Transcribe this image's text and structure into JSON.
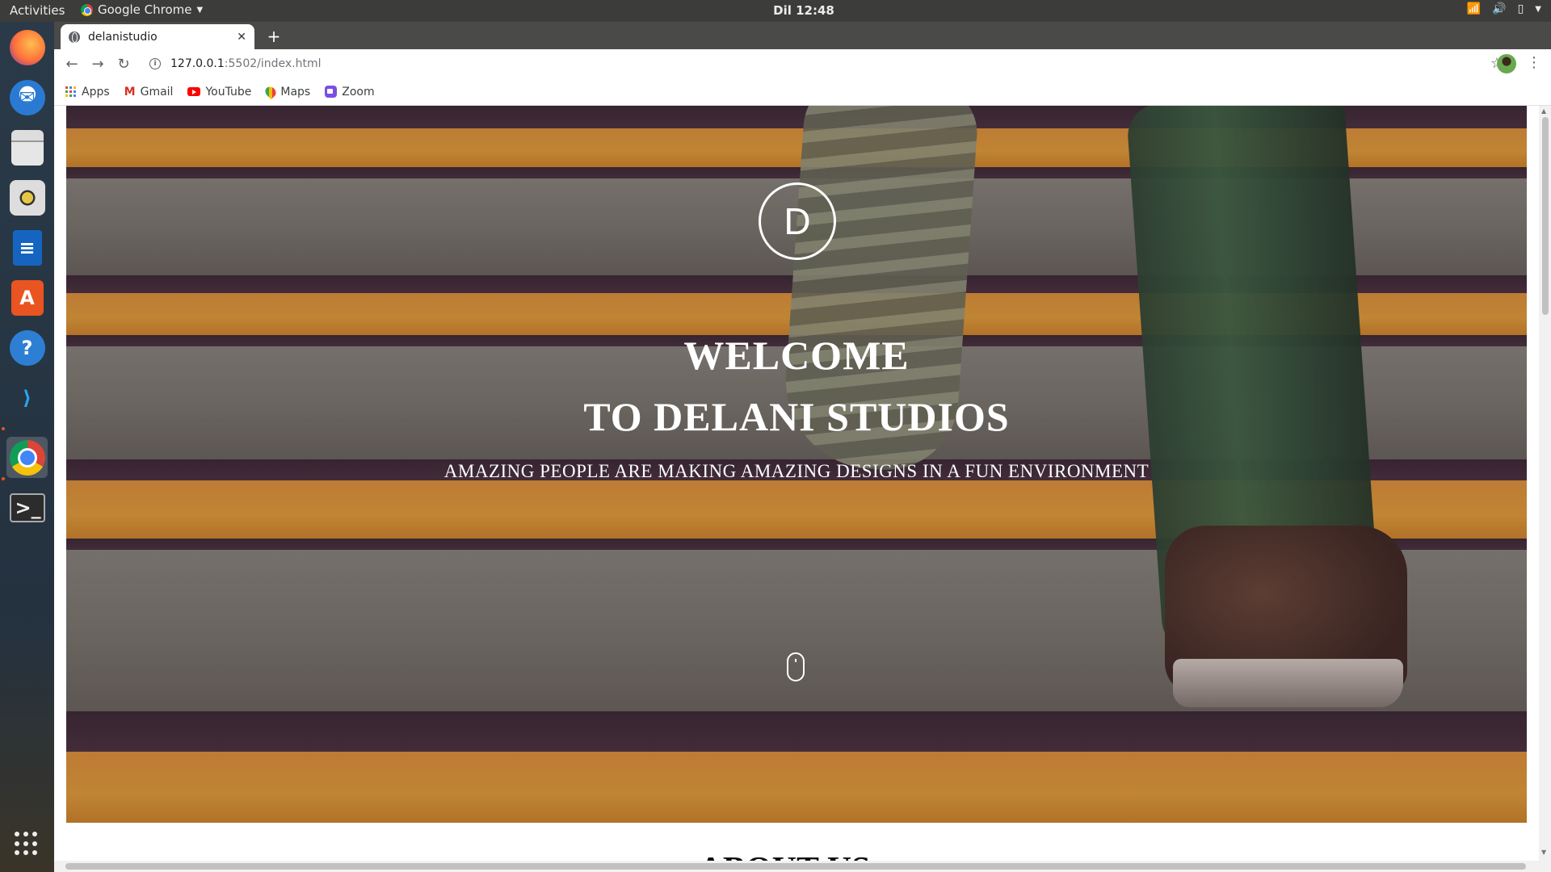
{
  "system": {
    "activities": "Activities",
    "app_name": "Google Chrome",
    "clock": "Dil 12:48"
  },
  "dock": {
    "items": [
      "Firefox",
      "Thunderbird",
      "Files",
      "Rhythmbox",
      "LibreOffice Writer",
      "Ubuntu Software",
      "Help",
      "Visual Studio Code",
      "Google Chrome",
      "Terminal"
    ],
    "active": "Google Chrome"
  },
  "browser": {
    "tab_title": "delanistudio",
    "url_host": "127.0.0.1",
    "url_path": ":5502/index.html",
    "bookmarks": [
      {
        "label": "Apps",
        "icon": "apps-grid-icon"
      },
      {
        "label": "Gmail",
        "icon": "gmail-icon"
      },
      {
        "label": "YouTube",
        "icon": "youtube-icon"
      },
      {
        "label": "Maps",
        "icon": "maps-icon"
      },
      {
        "label": "Zoom",
        "icon": "zoom-icon"
      }
    ]
  },
  "page": {
    "logo_letter": "D",
    "title_line1": "WELCOME",
    "title_line2": "TO DELANI STUDIOS",
    "subtitle": "AMAZING PEOPLE ARE MAKING AMAZING DESIGNS IN A FUN ENVIRONMENT",
    "next_section_heading": "ABOUT US"
  },
  "colors": {
    "stair_orange": "#e79a3a",
    "stair_dark": "#3a2a36",
    "hero_text": "#ffffff"
  }
}
